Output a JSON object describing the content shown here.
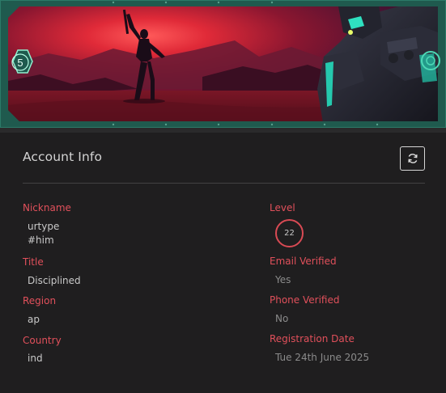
{
  "banner": {
    "badge_number": "5"
  },
  "account": {
    "title": "Account Info",
    "refresh_icon": "refresh-icon"
  },
  "fields": {
    "nickname": {
      "label": "Nickname",
      "value_line1": "urtype",
      "value_line2": "#him"
    },
    "title": {
      "label": "Title",
      "value": "Disciplined"
    },
    "region": {
      "label": "Region",
      "value": "ap"
    },
    "country": {
      "label": "Country",
      "value": "ind"
    },
    "level": {
      "label": "Level",
      "value": "22"
    },
    "email_verified": {
      "label": "Email Verified",
      "value": "Yes"
    },
    "phone_verified": {
      "label": "Phone Verified",
      "value": "No"
    },
    "registration_date": {
      "label": "Registration Date",
      "value": "Tue 24th June 2025"
    }
  },
  "colors": {
    "accent_red": "#e1505b",
    "banner_frame": "#1f5a4e",
    "background": "#1f1e1f"
  }
}
